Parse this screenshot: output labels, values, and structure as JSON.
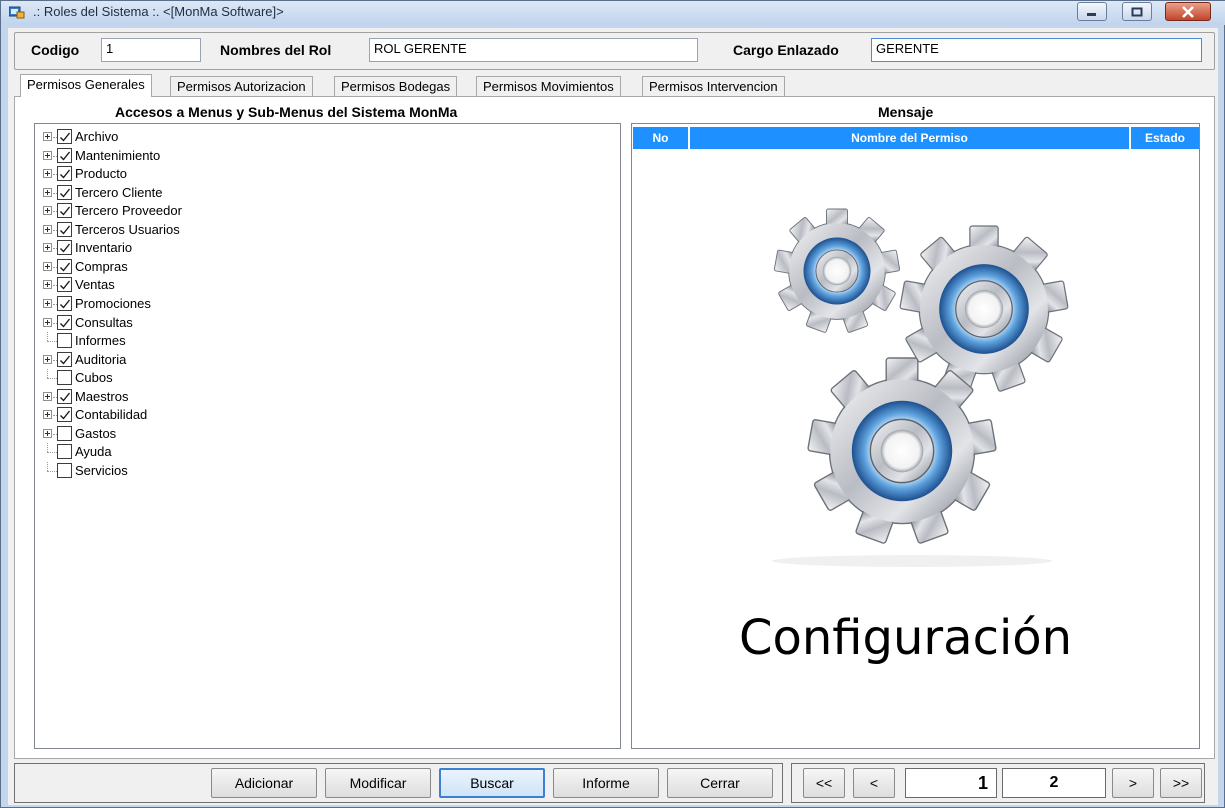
{
  "window": {
    "title": ".: Roles del Sistema :. <[MonMa Software]>"
  },
  "header": {
    "codigo_label": "Codigo",
    "codigo_value": "1",
    "nombres_label": "Nombres del Rol",
    "nombres_value": "ROL GERENTE",
    "cargo_label": "Cargo Enlazado",
    "cargo_value": "GERENTE"
  },
  "tabs": [
    {
      "label": "Permisos Generales",
      "active": true
    },
    {
      "label": "Permisos Autorizacion",
      "active": false
    },
    {
      "label": "Permisos Bodegas",
      "active": false
    },
    {
      "label": "Permisos Movimientos",
      "active": false
    },
    {
      "label": "Permisos Intervencion",
      "active": false
    }
  ],
  "tree": {
    "title": "Accesos a Menus y Sub-Menus del Sistema MonMa",
    "items": [
      {
        "label": "Archivo",
        "checked": true,
        "expandable": true
      },
      {
        "label": "Mantenimiento",
        "checked": true,
        "expandable": true
      },
      {
        "label": "Producto",
        "checked": true,
        "expandable": true
      },
      {
        "label": "Tercero Cliente",
        "checked": true,
        "expandable": true
      },
      {
        "label": "Tercero Proveedor",
        "checked": true,
        "expandable": true
      },
      {
        "label": "Terceros Usuarios",
        "checked": true,
        "expandable": true
      },
      {
        "label": "Inventario",
        "checked": true,
        "expandable": true
      },
      {
        "label": "Compras",
        "checked": true,
        "expandable": true
      },
      {
        "label": "Ventas",
        "checked": true,
        "expandable": true
      },
      {
        "label": "Promociones",
        "checked": true,
        "expandable": true
      },
      {
        "label": "Consultas",
        "checked": true,
        "expandable": true
      },
      {
        "label": "Informes",
        "checked": false,
        "expandable": false
      },
      {
        "label": "Auditoria",
        "checked": true,
        "expandable": true
      },
      {
        "label": "Cubos",
        "checked": false,
        "expandable": false
      },
      {
        "label": "Maestros",
        "checked": true,
        "expandable": true
      },
      {
        "label": "Contabilidad",
        "checked": true,
        "expandable": true
      },
      {
        "label": "Gastos",
        "checked": false,
        "expandable": true
      },
      {
        "label": "Ayuda",
        "checked": false,
        "expandable": false
      },
      {
        "label": "Servicios",
        "checked": false,
        "expandable": false
      }
    ]
  },
  "grid": {
    "title": "Mensaje",
    "columns": [
      "No",
      "Nombre del Permiso",
      "Estado"
    ],
    "header_color": "#1e90ff",
    "overlay_text": "Configuración"
  },
  "buttons": {
    "adicionar": "Adicionar",
    "modificar": "Modificar",
    "buscar": "Buscar",
    "informe": "Informe",
    "cerrar": "Cerrar"
  },
  "pager": {
    "first": "<<",
    "prev": "<",
    "current": "1",
    "total": "2",
    "next": ">",
    "last": ">>"
  }
}
